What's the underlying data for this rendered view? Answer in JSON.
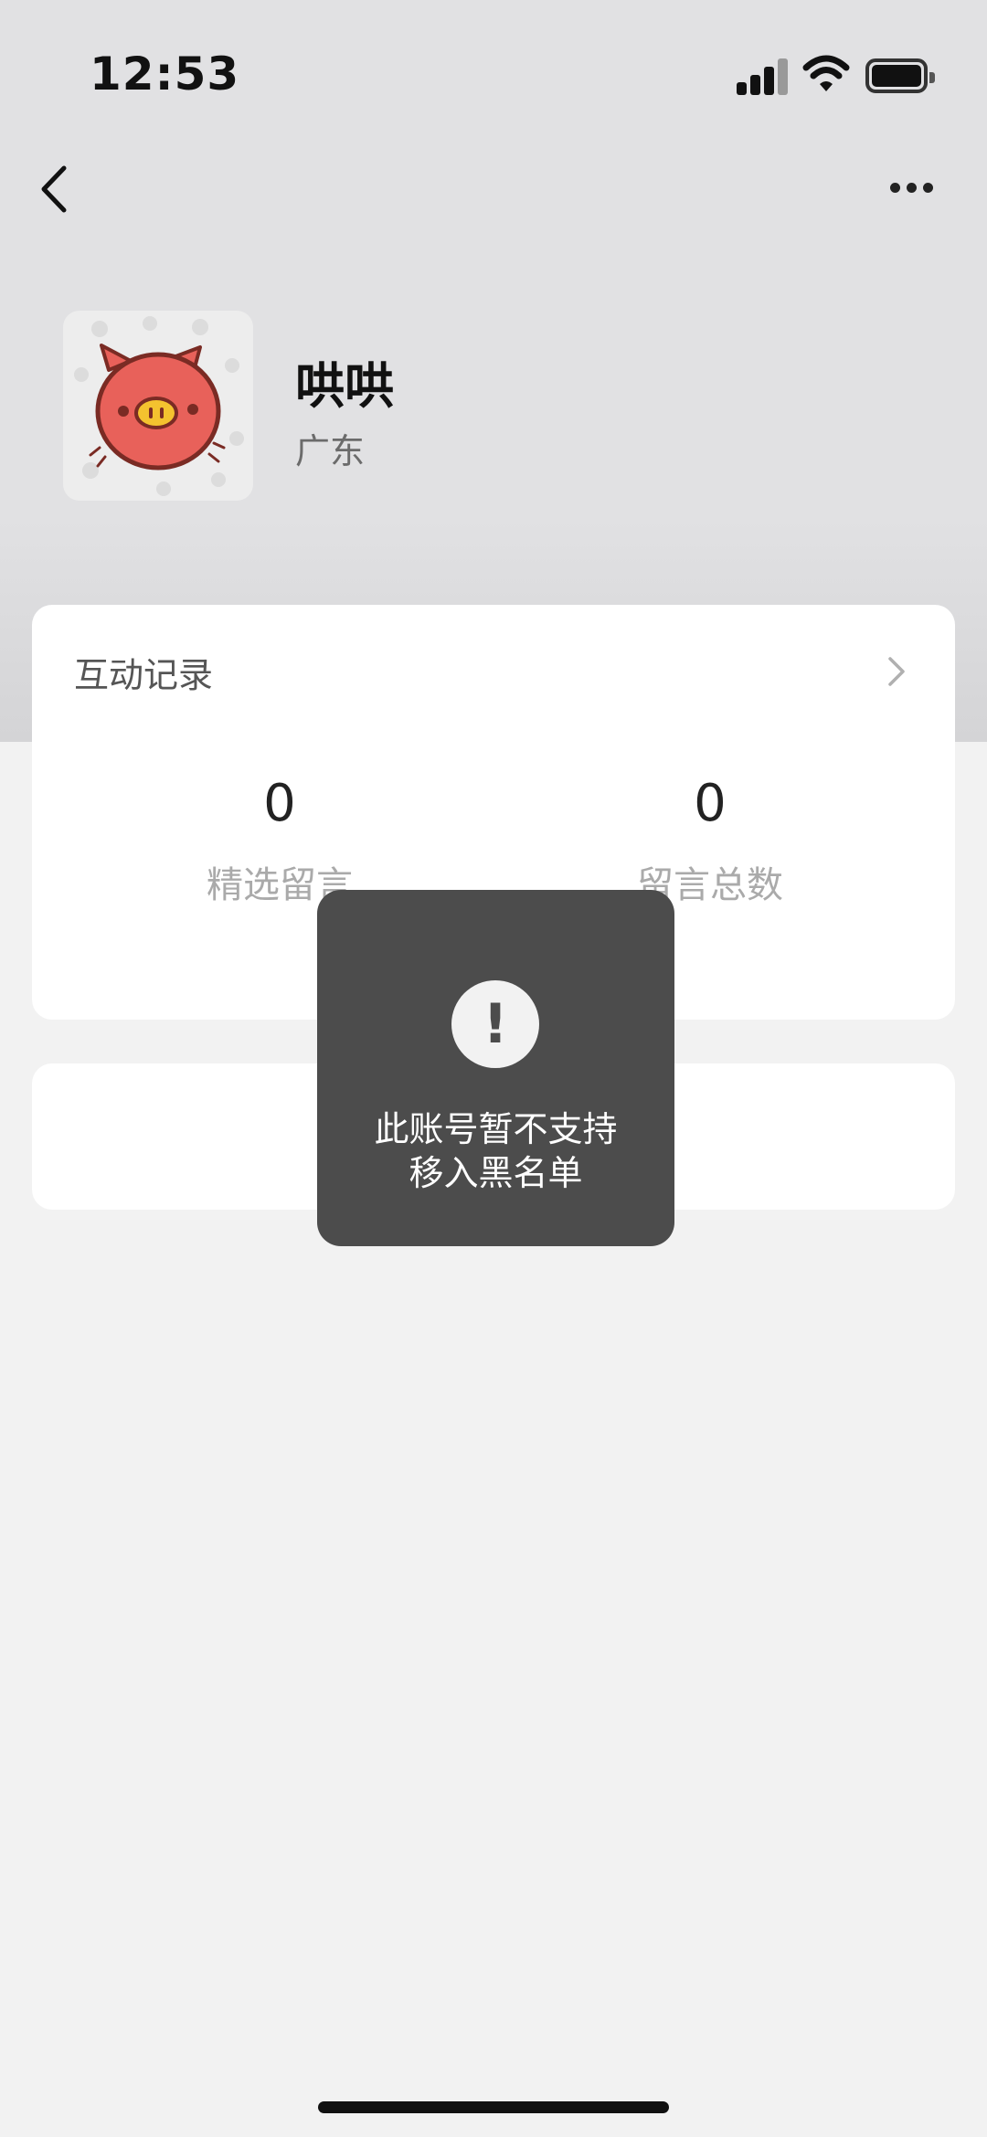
{
  "status_bar": {
    "time": "12:53"
  },
  "nav": {
    "back_icon": "chevron-left-icon",
    "more_icon": "ellipsis-icon"
  },
  "profile": {
    "name": "哄哄",
    "region": "广东",
    "avatar": "pig-sticker-avatar"
  },
  "interaction_card": {
    "title": "互动记录",
    "stats": [
      {
        "value": "0",
        "label": "精选留言"
      },
      {
        "value": "0",
        "label": "留言总数"
      }
    ]
  },
  "toast": {
    "icon": "exclamation-icon",
    "message_line1": "此账号暂不支持",
    "message_line2": "移入黑名单"
  },
  "colors": {
    "toast_bg": "#4c4c4c",
    "avatar_pig": "#e8615a",
    "page_bg": "#f2f2f2"
  }
}
